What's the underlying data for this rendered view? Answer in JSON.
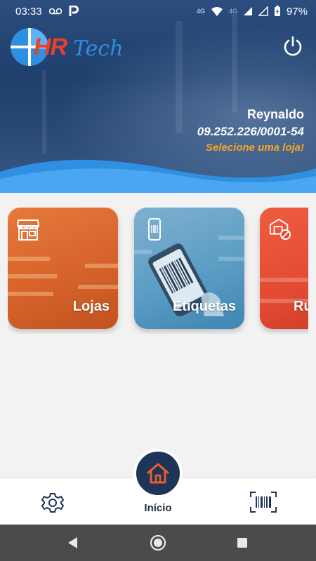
{
  "status_bar": {
    "time": "03:33",
    "network_label_1": "4G",
    "network_label_2": "4G",
    "battery": "97%"
  },
  "header": {
    "logo_text_hr": "HR",
    "logo_text_tech": "Tech",
    "user_name": "Reynaldo",
    "cnpj": "09.252.226/0001-54",
    "prompt": "Selecione uma loja!"
  },
  "cards": [
    {
      "label": "Lojas",
      "icon": "storefront-icon",
      "color": "#e0702f"
    },
    {
      "label": "Etiquetas",
      "icon": "phone-barcode-icon",
      "color": "#5b9dc4"
    },
    {
      "label": "Ru",
      "icon": "box-blocked-icon",
      "color": "#e24a33"
    }
  ],
  "bottom_nav": {
    "home_label": "Início",
    "settings_icon": "gear-icon",
    "scan_icon": "barcode-scan-icon",
    "home_icon": "house-icon"
  },
  "colors": {
    "accent_orange": "#f5a524",
    "navy": "#1d3558"
  }
}
